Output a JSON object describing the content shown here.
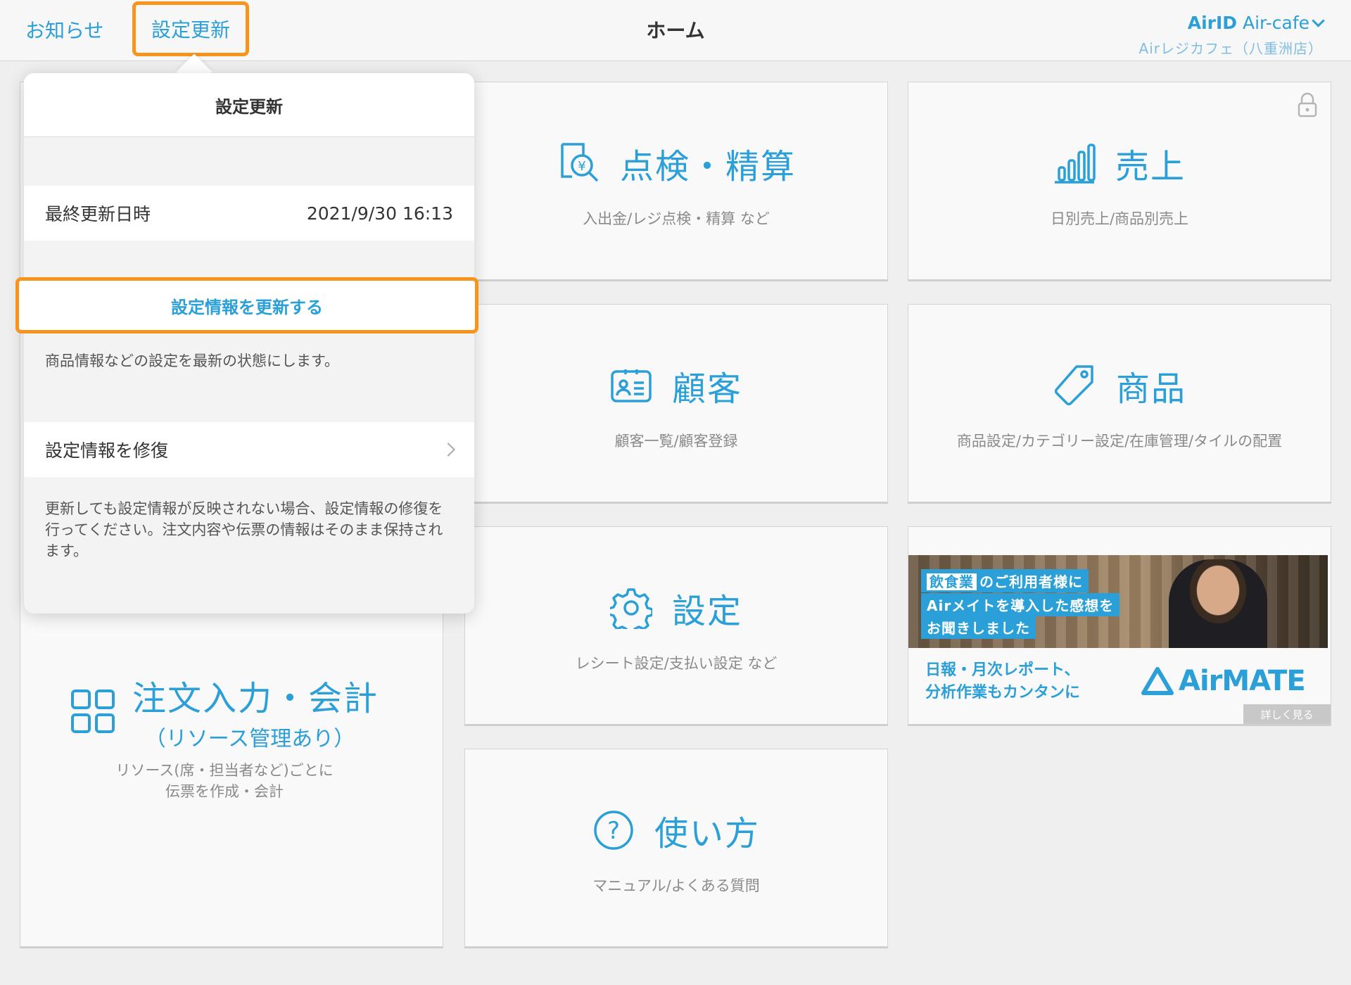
{
  "header": {
    "notice_label": "お知らせ",
    "settings_update_label": "設定更新",
    "title": "ホーム",
    "account_prefix": "AirID",
    "account_name": "Air-cafe",
    "store_name": "Airレジカフェ（八重洲店）"
  },
  "tiles": {
    "inspection": {
      "title": "点検・精算",
      "subtitle": "入出金/レジ点検・精算 など"
    },
    "sales": {
      "title": "売上",
      "subtitle": "日別売上/商品別売上"
    },
    "customer": {
      "title": "顧客",
      "subtitle": "顧客一覧/顧客登録"
    },
    "product": {
      "title": "商品",
      "subtitle": "商品設定/カテゴリー設定/在庫管理/タイルの配置"
    },
    "settings": {
      "title": "設定",
      "subtitle": "レシート設定/支払い設定 など"
    },
    "order": {
      "title": "注文入力・会計",
      "title_sub": "（リソース管理あり）",
      "subtitle_line1": "リソース(席・担当者など)ごとに",
      "subtitle_line2": "伝票を作成・会計"
    },
    "howto": {
      "title": "使い方",
      "subtitle": "マニュアル/よくある質問"
    }
  },
  "ad": {
    "tag_highlight": "飲食業",
    "tag_line1": "のご利用者様に",
    "tag_line2": "Airメイトを導入した感想を",
    "tag_line3": "お聞きしました",
    "copy_line1": "日報・月次レポート、",
    "copy_line2": "分析作業もカンタンに",
    "logo": "AirMATE",
    "more": "詳しく見る"
  },
  "popover": {
    "title": "設定更新",
    "last_updated_label": "最終更新日時",
    "last_updated_value": "2021/9/30 16:13",
    "update_button": "設定情報を更新する",
    "update_note": "商品情報などの設定を最新の状態にします。",
    "repair_label": "設定情報を修復",
    "repair_note": "更新しても設定情報が反映されない場合、設定情報の修復を行ってください。注文内容や伝票の情報はそのまま保持されます。"
  },
  "colors": {
    "accent": "#2a9fd8",
    "highlight": "#f7941d",
    "background": "#efefef"
  }
}
